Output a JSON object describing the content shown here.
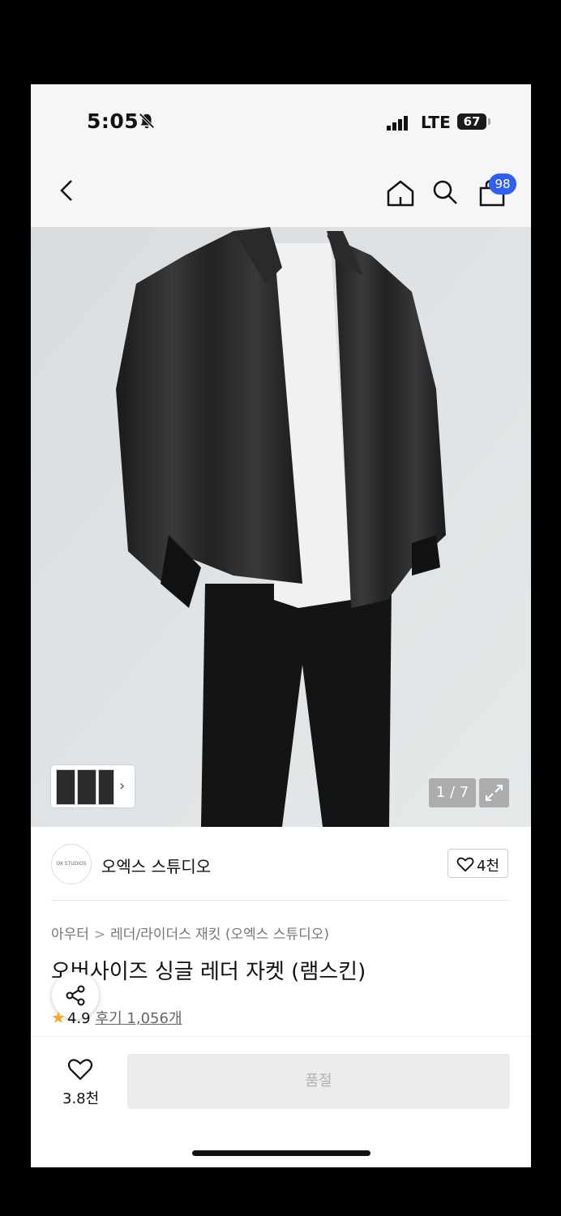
{
  "status_bar": {
    "time": "5:05",
    "network": "LTE",
    "battery": "67"
  },
  "nav": {
    "cart_count": "98"
  },
  "gallery": {
    "counter": "1 / 7",
    "expand_icon": "expand-icon"
  },
  "brand": {
    "logo_text": "OX STUDIOS",
    "name": "오엑스 스튜디오",
    "likes": "4천"
  },
  "breadcrumb": {
    "category": "아우터",
    "separator": ">",
    "subcategory": "레더/라이더스 재킷 (오엑스 스튜디오)"
  },
  "product": {
    "title": "오버사이즈 싱글 레더 자켓 (램스킨)",
    "rating": "4.9",
    "reviews": "후기 1,056개"
  },
  "bottom_bar": {
    "wish_count": "3.8천",
    "soldout_label": "품절"
  },
  "colors": {
    "badge": "#2f5ff5",
    "star": "#f5a623",
    "soldout_bg": "#ececec"
  }
}
